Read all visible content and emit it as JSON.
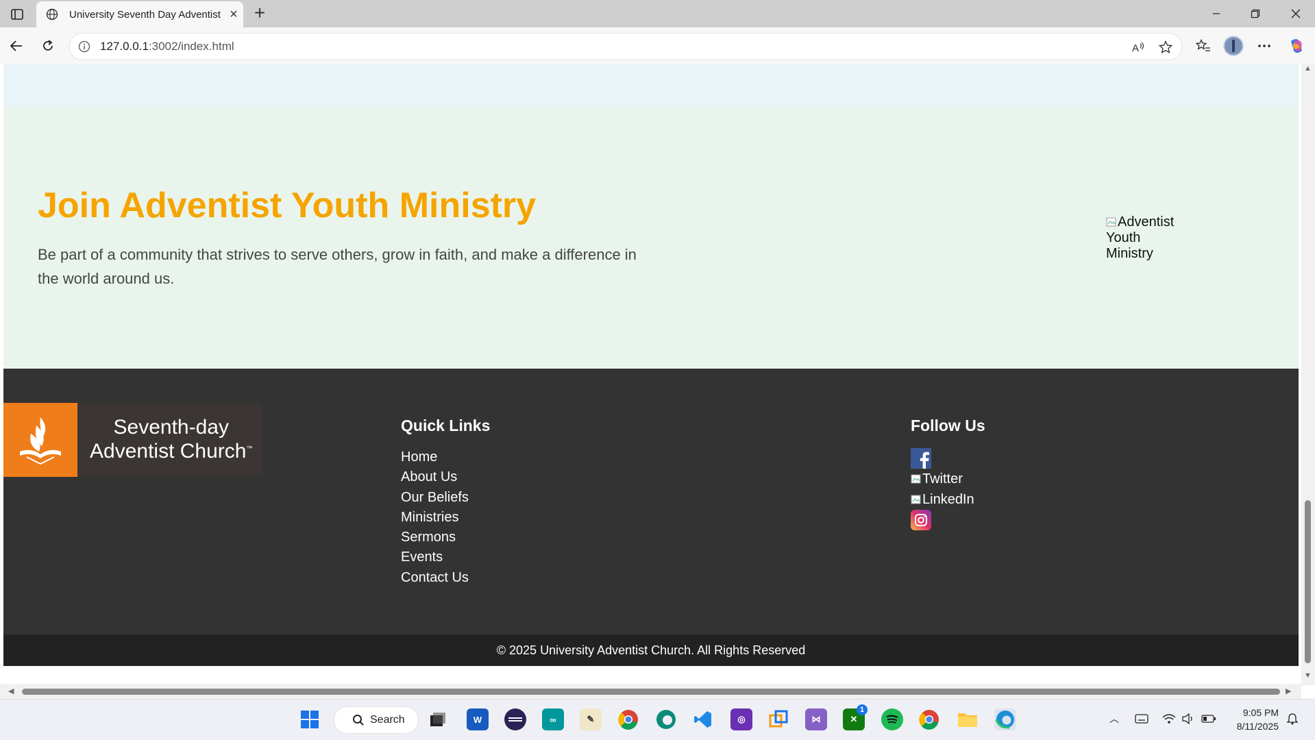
{
  "browser": {
    "tab_title": "University Seventh Day Adventist Church",
    "url_host": "127.0.0.1",
    "url_path": ":3002/index.html",
    "icons": [
      "tab-actions-icon",
      "globe-icon",
      "close-icon",
      "plus-icon",
      "minimize-icon",
      "restore-icon",
      "back-icon",
      "refresh-icon",
      "info-icon",
      "read-aloud-icon",
      "favorite-star-icon",
      "favorites-icon",
      "profile-avatar",
      "more-icon",
      "copilot-icon"
    ]
  },
  "youth": {
    "title": "Join Adventist Youth Ministry",
    "description": "Be part of a community that strives to serve others, grow in faith, and make a difference in the world around us.",
    "image_alt": "Adventist Youth Ministry"
  },
  "footer": {
    "logo_line1": "Seventh-day",
    "logo_line2": "Adventist Church",
    "logo_tm": "™",
    "quick_links_heading": "Quick Links",
    "quick_links": [
      "Home",
      "About Us",
      "Our Beliefs",
      "Ministries",
      "Sermons",
      "Events",
      "Contact Us"
    ],
    "follow_heading": "Follow Us",
    "social": {
      "twitter_alt": "Twitter",
      "linkedin_alt": "LinkedIn"
    },
    "copyright": "© 2025 University Adventist Church. All Rights Reserved"
  },
  "taskbar": {
    "search_label": "Search",
    "time": "9:05 PM",
    "date": "8/11/2025",
    "xbox_badge": "1"
  },
  "colors": {
    "accent_orange": "#f5a400",
    "footer_bg": "#333333",
    "copyright_bg": "#222222",
    "youth_bg": "#e9f5ec",
    "top_band_bg": "#e8f4f8",
    "logo_orange": "#ef7d1a"
  }
}
